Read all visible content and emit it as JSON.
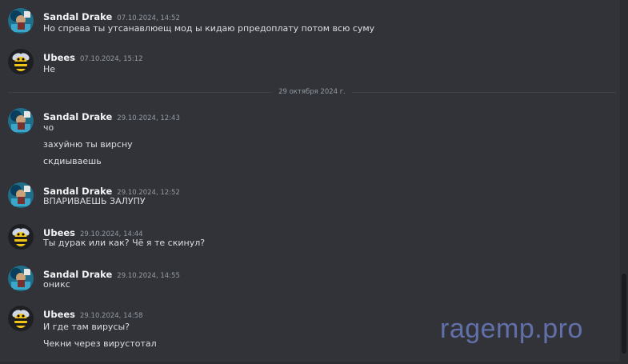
{
  "divider": {
    "label": "29 октября 2024 г."
  },
  "messages": [
    {
      "author": "Sandal Drake",
      "time": "07.10.2024, 14:52",
      "avatar": "sandal-avatar",
      "lines": [
        "Но спрева ты утсанавлюещ мод ы кидаю рпредоплату потом всю суму"
      ]
    },
    {
      "author": "Ubees",
      "time": "07.10.2024, 15:12",
      "avatar": "bee-avatar",
      "lines": [
        "Не"
      ]
    },
    {
      "author": "Sandal Drake",
      "time": "29.10.2024, 12:43",
      "avatar": "sandal-avatar",
      "lines": [
        "чо",
        "захуйню ты вирсну",
        "скдиываешь"
      ]
    },
    {
      "author": "Sandal Drake",
      "time": "29.10.2024, 12:52",
      "avatar": "sandal-avatar",
      "lines": [
        "ВПАРИВАЕШЬ ЗАЛУПУ"
      ]
    },
    {
      "author": "Ubees",
      "time": "29.10.2024, 14:44",
      "avatar": "bee-avatar",
      "lines": [
        "Ты дурак или как? Чё я те скинул?"
      ]
    },
    {
      "author": "Sandal Drake",
      "time": "29.10.2024, 14:55",
      "avatar": "sandal-avatar",
      "lines": [
        "оникс"
      ]
    },
    {
      "author": "Ubees",
      "time": "29.10.2024, 14:58",
      "avatar": "bee-avatar",
      "lines": [
        "И где там вирусы?",
        "Чекни через вирустотал"
      ]
    }
  ],
  "watermark": {
    "text": "ragemp.pro"
  },
  "colors": {
    "background": "#313338",
    "author": "#f2f3f5",
    "timestamp": "#949ba4",
    "text": "#dbdee1"
  }
}
